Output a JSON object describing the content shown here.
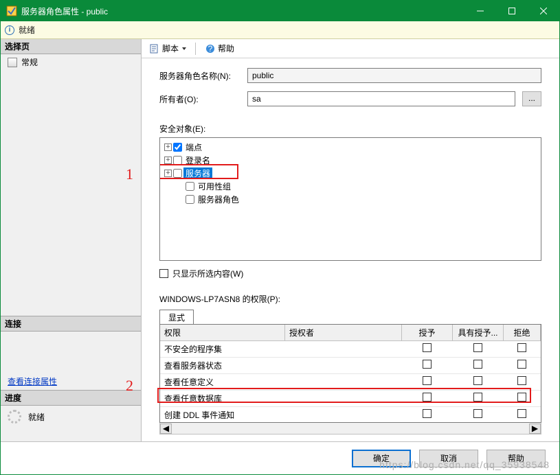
{
  "window": {
    "title": "服务器角色属性 - public",
    "status": "就绪"
  },
  "sidebar": {
    "select_page": "选择页",
    "pages": {
      "general": "常规"
    },
    "connection_header": "连接",
    "view_conn_props": "查看连接属性",
    "progress_header": "进度",
    "progress_status": "就绪"
  },
  "toolbar": {
    "script": "脚本",
    "help": "帮助"
  },
  "form": {
    "name_label": "服务器角色名称(N):",
    "name_value": "public",
    "owner_label": "所有者(O):",
    "owner_value": "sa",
    "browse": "..."
  },
  "securables": {
    "label": "安全对象(E):",
    "items": [
      {
        "label": "端点",
        "expandable": true,
        "checked": true
      },
      {
        "label": "登录名",
        "expandable": true,
        "checked": false
      },
      {
        "label": "服务器",
        "expandable": true,
        "checked": false,
        "selected": true
      },
      {
        "label": "可用性组",
        "expandable": false,
        "checked": false
      },
      {
        "label": "服务器角色",
        "expandable": false,
        "checked": false
      }
    ],
    "only_show_selected": "只显示所选内容(W)"
  },
  "permissions": {
    "header": "WINDOWS-LP7ASN8 的权限(P):",
    "tab": "显式",
    "columns": {
      "perm": "权限",
      "grantor": "授权者",
      "grant": "授予",
      "with_grant": "具有授予...",
      "deny": "拒绝"
    },
    "rows": [
      {
        "perm": "不安全的程序集"
      },
      {
        "perm": "查看服务器状态"
      },
      {
        "perm": "查看任意定义"
      },
      {
        "perm": "查看任意数据库"
      },
      {
        "perm": "创建 DDL 事件通知"
      }
    ]
  },
  "buttons": {
    "ok": "确定",
    "cancel": "取消",
    "help": "帮助"
  },
  "annotations": {
    "one": "1",
    "two": "2"
  },
  "watermark": "https://blog.csdn.net/qq_35938548",
  "chart_data": null
}
